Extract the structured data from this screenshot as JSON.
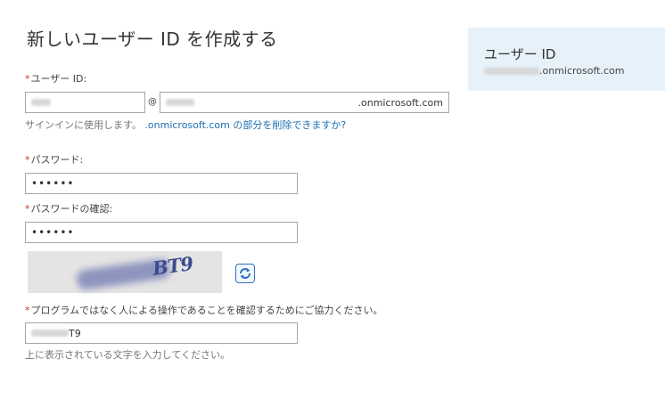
{
  "page": {
    "title": "新しいユーザー ID を作成する"
  },
  "form": {
    "required_marker": "*",
    "userid": {
      "label": "ユーザー ID:",
      "at_sign": "@",
      "domain_suffix": ".onmicrosoft.com",
      "hint_prefix": "サインインに使用します。",
      "hint_link": ".onmicrosoft.com の部分を削除できますか?"
    },
    "password": {
      "label": "パスワード:",
      "value": "••••••"
    },
    "password_confirm": {
      "label": "パスワードの確認:",
      "value": "••••••"
    },
    "captcha": {
      "visible_text": "BT9",
      "refresh_icon": "refresh-icon",
      "label": "プログラムではなく人による操作であることを確認するためにご協力ください。",
      "value_suffix": "T9",
      "hint": "上に表示されている文字を入力してください。"
    }
  },
  "sidebar": {
    "title": "ユーザー ID",
    "domain_suffix": ".onmicrosoft.com"
  },
  "colors": {
    "required": "#c8332c",
    "link": "#1a6fb4",
    "sidebar_bg": "#e6f1f9"
  }
}
